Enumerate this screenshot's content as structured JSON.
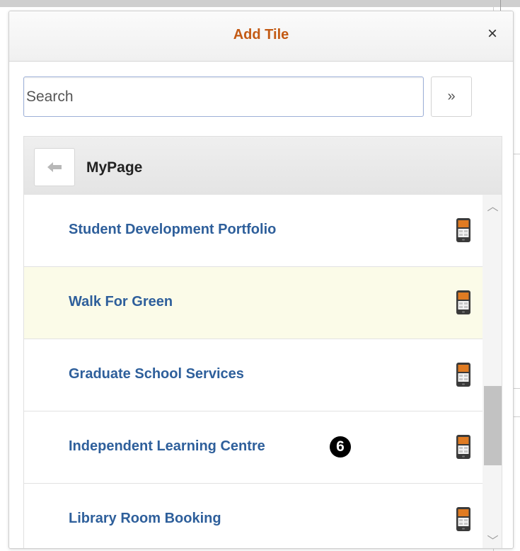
{
  "dialog": {
    "title": "Add Tile",
    "close_label": "×"
  },
  "search": {
    "placeholder": "Search",
    "value": "",
    "go_label": "»"
  },
  "panel": {
    "title": "MyPage",
    "back_icon": "left-arrow-icon"
  },
  "items": [
    {
      "label": "Student Development Portfolio",
      "icon": "mobile-device-icon",
      "highlighted": false
    },
    {
      "label": "Walk For Green",
      "icon": "mobile-device-icon",
      "highlighted": true
    },
    {
      "label": "Graduate School Services",
      "icon": "mobile-device-icon",
      "highlighted": false
    },
    {
      "label": "Independent Learning Centre",
      "icon": "mobile-device-icon",
      "highlighted": false
    },
    {
      "label": "Library Room Booking",
      "icon": "mobile-device-icon",
      "highlighted": false
    }
  ],
  "annotation": {
    "step_number": "6"
  },
  "scrollbar": {
    "up_glyph": "︿",
    "down_glyph": "﹀"
  },
  "colors": {
    "title": "#c35a14",
    "link": "#2e5f9b",
    "highlight": "#fbfbe8",
    "icon_accent": "#e07b22"
  }
}
